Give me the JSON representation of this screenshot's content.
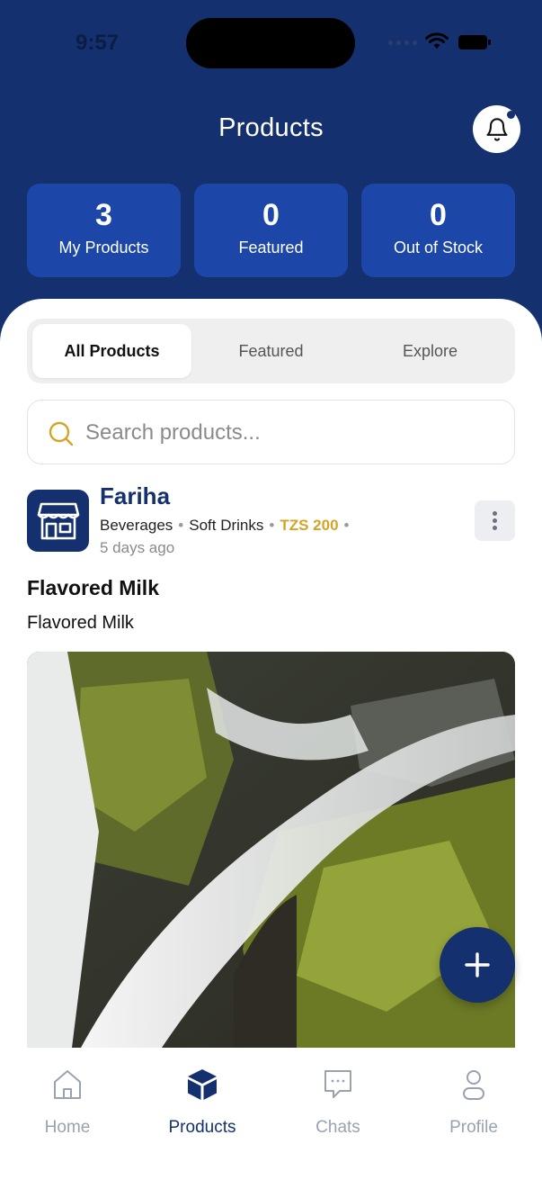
{
  "status_bar": {
    "time": "9:57"
  },
  "header": {
    "title": "Products",
    "notification_icon": "bell-icon"
  },
  "stats": [
    {
      "value": "3",
      "label": "My Products"
    },
    {
      "value": "0",
      "label": "Featured"
    },
    {
      "value": "0",
      "label": "Out of Stock"
    }
  ],
  "tabs": [
    {
      "label": "All Products",
      "active": true
    },
    {
      "label": "Featured",
      "active": false
    },
    {
      "label": "Explore",
      "active": false
    }
  ],
  "search": {
    "placeholder": "Search products...",
    "value": ""
  },
  "post": {
    "author": "Fariha",
    "category": "Beverages",
    "subcategory": "Soft Drinks",
    "price": "TZS 200",
    "time": "5 days ago",
    "title": "Flavored Milk",
    "description": "Flavored Milk",
    "avatar_icon": "store-icon",
    "menu_icon": "more-vertical-icon"
  },
  "fab": {
    "icon": "plus-icon"
  },
  "bottom_nav": [
    {
      "label": "Home",
      "icon": "home-icon",
      "active": false
    },
    {
      "label": "Products",
      "icon": "box-icon",
      "active": true
    },
    {
      "label": "Chats",
      "icon": "chat-icon",
      "active": false
    },
    {
      "label": "Profile",
      "icon": "user-icon",
      "active": false
    }
  ],
  "colors": {
    "primary": "#14306e",
    "stat_card": "#1c47a8",
    "price": "#d4a425",
    "nav_inactive": "#9aa2b1"
  }
}
